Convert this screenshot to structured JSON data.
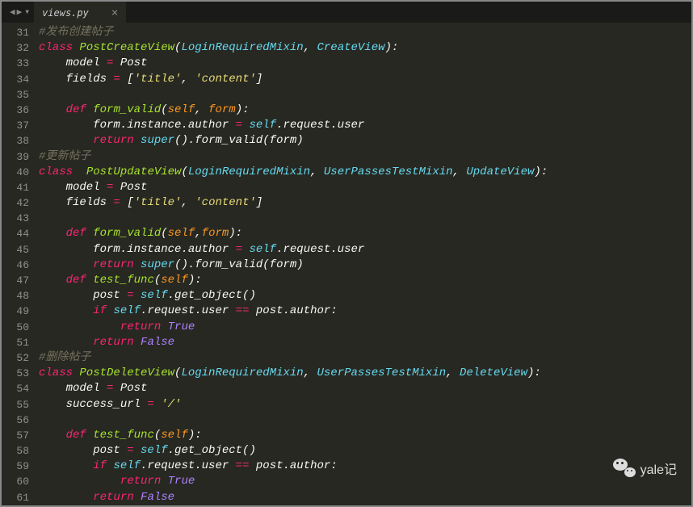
{
  "tab": {
    "filename": "views.py",
    "close": "×"
  },
  "lines": [
    {
      "n": 31,
      "html": "<span class='c-comment'>#发布创建帖子</span>"
    },
    {
      "n": 32,
      "html": "<span class='c-storage'>class</span> <span class='c-classname'>PostCreateView</span>(<span class='c-params-type'>LoginRequiredMixin</span>, <span class='c-params-type'>CreateView</span>):"
    },
    {
      "n": 33,
      "html": "    model <span class='c-op'>=</span> Post"
    },
    {
      "n": 34,
      "html": "    fields <span class='c-op'>=</span> [<span class='c-string'>'title'</span>, <span class='c-string'>'content'</span>]"
    },
    {
      "n": 35,
      "html": ""
    },
    {
      "n": 36,
      "html": "    <span class='c-storage'>def</span> <span class='c-funcname'>form_valid</span>(<span class='c-param'>self</span>, <span class='c-param'>form</span>):"
    },
    {
      "n": 37,
      "html": "        form.instance.author <span class='c-op'>=</span> <span class='c-builtin'>self</span>.request.user"
    },
    {
      "n": 38,
      "html": "        <span class='c-storage'>return</span> <span class='c-builtin'>super</span>().form_valid(form)"
    },
    {
      "n": 39,
      "html": "<span class='c-comment'>#更新帖子</span>"
    },
    {
      "n": 40,
      "html": "<span class='c-storage'>class</span>  <span class='c-classname'>PostUpdateView</span>(<span class='c-params-type'>LoginRequiredMixin</span>, <span class='c-params-type'>UserPassesTestMixin</span>, <span class='c-params-type'>UpdateView</span>):"
    },
    {
      "n": 41,
      "html": "    model <span class='c-op'>=</span> Post"
    },
    {
      "n": 42,
      "html": "    fields <span class='c-op'>=</span> [<span class='c-string'>'title'</span>, <span class='c-string'>'content'</span>]"
    },
    {
      "n": 43,
      "html": ""
    },
    {
      "n": 44,
      "html": "    <span class='c-storage'>def</span> <span class='c-funcname'>form_valid</span>(<span class='c-param'>self</span>,<span class='c-param'>form</span>):"
    },
    {
      "n": 45,
      "html": "        form.instance.author <span class='c-op'>=</span> <span class='c-builtin'>self</span>.request.user"
    },
    {
      "n": 46,
      "html": "        <span class='c-storage'>return</span> <span class='c-builtin'>super</span>().form_valid(form)"
    },
    {
      "n": 47,
      "html": "    <span class='c-storage'>def</span> <span class='c-funcname'>test_func</span>(<span class='c-param'>self</span>):"
    },
    {
      "n": 48,
      "html": "        post <span class='c-op'>=</span> <span class='c-builtin'>self</span>.get_object()"
    },
    {
      "n": 49,
      "html": "        <span class='c-storage'>if</span> <span class='c-builtin'>self</span>.request.user <span class='c-op'>==</span> post.author:"
    },
    {
      "n": 50,
      "html": "            <span class='c-storage'>return</span> <span class='c-const'>True</span>"
    },
    {
      "n": 51,
      "html": "        <span class='c-storage'>return</span> <span class='c-const'>False</span>"
    },
    {
      "n": 52,
      "html": "<span class='c-comment'>#删除帖子</span>"
    },
    {
      "n": 53,
      "html": "<span class='c-storage'>class</span> <span class='c-classname'>PostDeleteView</span>(<span class='c-params-type'>LoginRequiredMixin</span>, <span class='c-params-type'>UserPassesTestMixin</span>, <span class='c-params-type'>DeleteView</span>):"
    },
    {
      "n": 54,
      "html": "    model <span class='c-op'>=</span> Post"
    },
    {
      "n": 55,
      "html": "    success_url <span class='c-op'>=</span> <span class='c-string'>'/'</span>"
    },
    {
      "n": 56,
      "html": ""
    },
    {
      "n": 57,
      "html": "    <span class='c-storage'>def</span> <span class='c-funcname'>test_func</span>(<span class='c-param'>self</span>):"
    },
    {
      "n": 58,
      "html": "        post <span class='c-op'>=</span> <span class='c-builtin'>self</span>.get_object()"
    },
    {
      "n": 59,
      "html": "        <span class='c-storage'>if</span> <span class='c-builtin'>self</span>.request.user <span class='c-op'>==</span> post.author:"
    },
    {
      "n": 60,
      "html": "            <span class='c-storage'>return</span> <span class='c-const'>True</span>"
    },
    {
      "n": 61,
      "html": "        <span class='c-storage'>return</span> <span class='c-const'>False</span>"
    }
  ],
  "watermark": {
    "text": "yale记"
  }
}
